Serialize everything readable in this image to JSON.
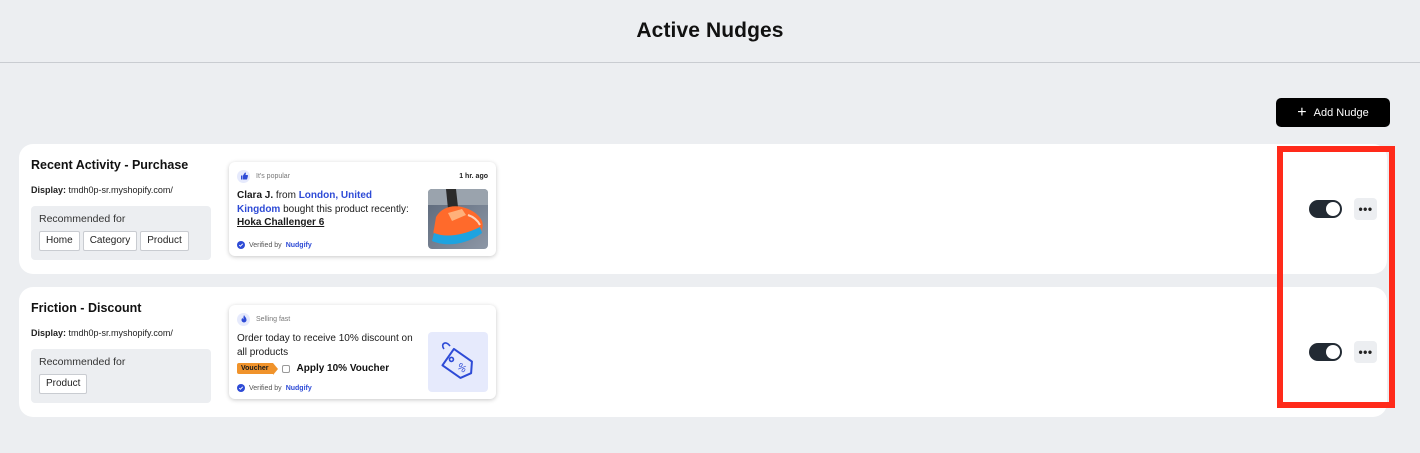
{
  "header": {
    "title": "Active Nudges"
  },
  "toolbar": {
    "add_label": "Add Nudge"
  },
  "highlight_color": "#ff2a1a",
  "nudges": [
    {
      "title": "Recent Activity - Purchase",
      "display_label": "Display:",
      "display_value": "tmdh0p-sr.myshopify.com/",
      "recommended_label": "Recommended for",
      "tags": [
        "Home",
        "Category",
        "Product"
      ],
      "preview": {
        "icon": "thumbs-up-icon",
        "tagline": "It's popular",
        "time": "1 hr. ago",
        "name": "Clara J.",
        "from": "from",
        "location": "London, United Kingdom",
        "bought": "bought this product recently:",
        "product": "Hoka Challenger 6",
        "verified_by": "Verified by",
        "verifier": "Nudgify"
      },
      "enabled": true
    },
    {
      "title": "Friction - Discount",
      "display_label": "Display:",
      "display_value": "tmdh0p-sr.myshopify.com/",
      "recommended_label": "Recommended for",
      "tags": [
        "Product"
      ],
      "preview": {
        "icon": "flame-icon",
        "tagline": "Selling fast",
        "message": "Order today to receive 10% discount on all products",
        "voucher_tag": "Voucher",
        "apply_label": "Apply 10% Voucher",
        "verified_by": "Verified by",
        "verifier": "Nudgify"
      },
      "enabled": true
    }
  ]
}
